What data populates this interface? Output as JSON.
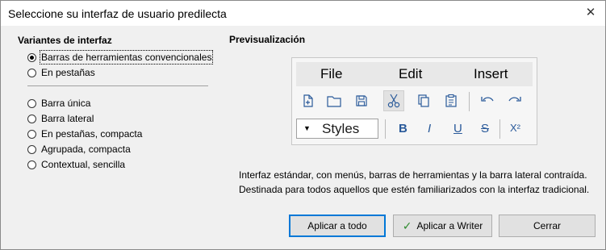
{
  "dialog": {
    "title": "Seleccione su interfaz de usuario predilecta",
    "close_glyph": "✕"
  },
  "variants": {
    "title": "Variantes de interfaz",
    "options": [
      {
        "label": "Barras de herramientas convencionales",
        "selected": true
      },
      {
        "label": "En pestañas",
        "selected": false
      },
      {
        "label": "Barra única",
        "selected": false
      },
      {
        "label": "Barra lateral",
        "selected": false
      },
      {
        "label": "En pestañas, compacta",
        "selected": false
      },
      {
        "label": "Agrupada, compacta",
        "selected": false
      },
      {
        "label": "Contextual, sencilla",
        "selected": false
      }
    ]
  },
  "preview": {
    "title": "Previsualización",
    "menus": [
      "File",
      "Edit",
      "Insert"
    ],
    "styles_label": "Styles",
    "styles_arrow": "▼",
    "format_buttons": [
      "B",
      "I",
      "U",
      "S",
      "X²"
    ],
    "toolbar_icons": [
      "new-document-icon",
      "open-folder-icon",
      "save-icon",
      "cut-icon",
      "copy-icon",
      "paste-icon",
      "undo-icon",
      "redo-icon"
    ]
  },
  "description": {
    "line1": "Interfaz estándar, con menús, barras de herramientas y la barra lateral contraída.",
    "line2": "Destinada para todos aquellos que estén familiarizados con la interfaz tradicional."
  },
  "buttons": {
    "apply_all": "Aplicar a todo",
    "apply_writer": "Aplicar a Writer",
    "close": "Cerrar"
  },
  "colors": {
    "accent": "#0078d7",
    "check": "#2e8b2e",
    "format_blue": "#2a5a9a"
  }
}
